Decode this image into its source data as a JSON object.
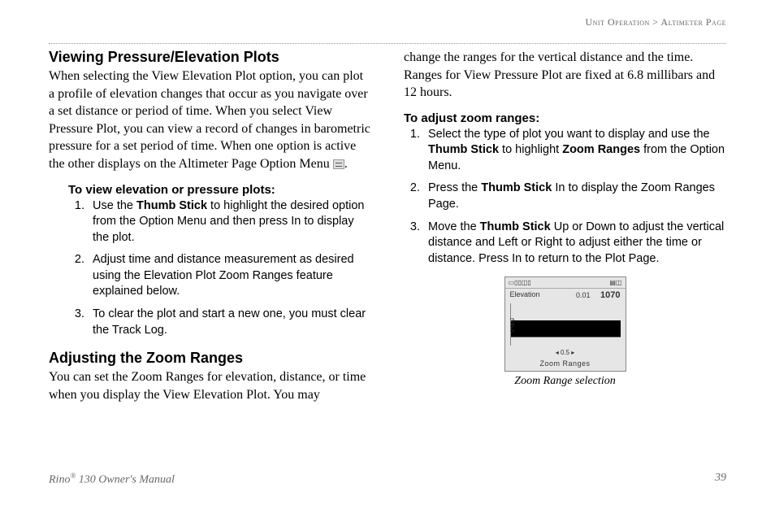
{
  "breadcrumb": {
    "section": "Unit Operation",
    "sep": ">",
    "page": "Altimeter Page"
  },
  "col1": {
    "h1": "Viewing Pressure/Elevation Plots",
    "p1a": "When selecting the View Elevation Plot option, you can plot a profile of elevation changes that occur as you navigate over a set distance or period of time. When you select View Pressure Plot, you can view a record of changes in barometric pressure for a set period of time. When one option is active the other displays on the Altimeter Page Option Menu ",
    "p1b": ".",
    "sub1": "To view elevation or pressure plots:",
    "s1_1a": "Use the ",
    "s1_1b": "Thumb Stick",
    "s1_1c": " to highlight the desired option from the Option Menu and then press In to display the plot.",
    "s1_2": "Adjust time and distance measurement as desired using the Elevation Plot Zoom Ranges feature explained below.",
    "s1_3": "To clear the plot and start a new one, you must clear the Track Log.",
    "h2": "Adjusting the Zoom Ranges",
    "p2": "You can set the Zoom Ranges for elevation, distance, or time when you display the View Elevation Plot. You may"
  },
  "col2": {
    "p1": "change the ranges for the vertical distance and the time. Ranges for View Pressure Plot are fixed at 6.8 millibars and 12 hours.",
    "sub1": "To adjust zoom ranges:",
    "s1a": "Select the type of plot you want to display and use the ",
    "s1b": "Thumb Stick",
    "s1c": " to highlight ",
    "s1d": "Zoom Ranges",
    "s1e": " from the Option Menu.",
    "s2a": "Press the ",
    "s2b": "Thumb Stick",
    "s2c": " In to display the Zoom Ranges Page.",
    "s3a": "Move the ",
    "s3b": "Thumb Stick",
    "s3c": " Up or Down to adjust the vertical distance and Left or Right to adjust either the time or distance. Press In to return to the Plot Page.",
    "fig": {
      "field_label": "Elevation",
      "field_value_left": "0.01",
      "field_value_right": "1070",
      "yaxis": "600.0",
      "xaxis": "0.5",
      "screen_label": "Zoom Ranges",
      "caption": "Zoom Range selection"
    }
  },
  "footer": {
    "product_a": "Rino",
    "product_b": " 130 Owner's Manual",
    "page_number": "39"
  }
}
